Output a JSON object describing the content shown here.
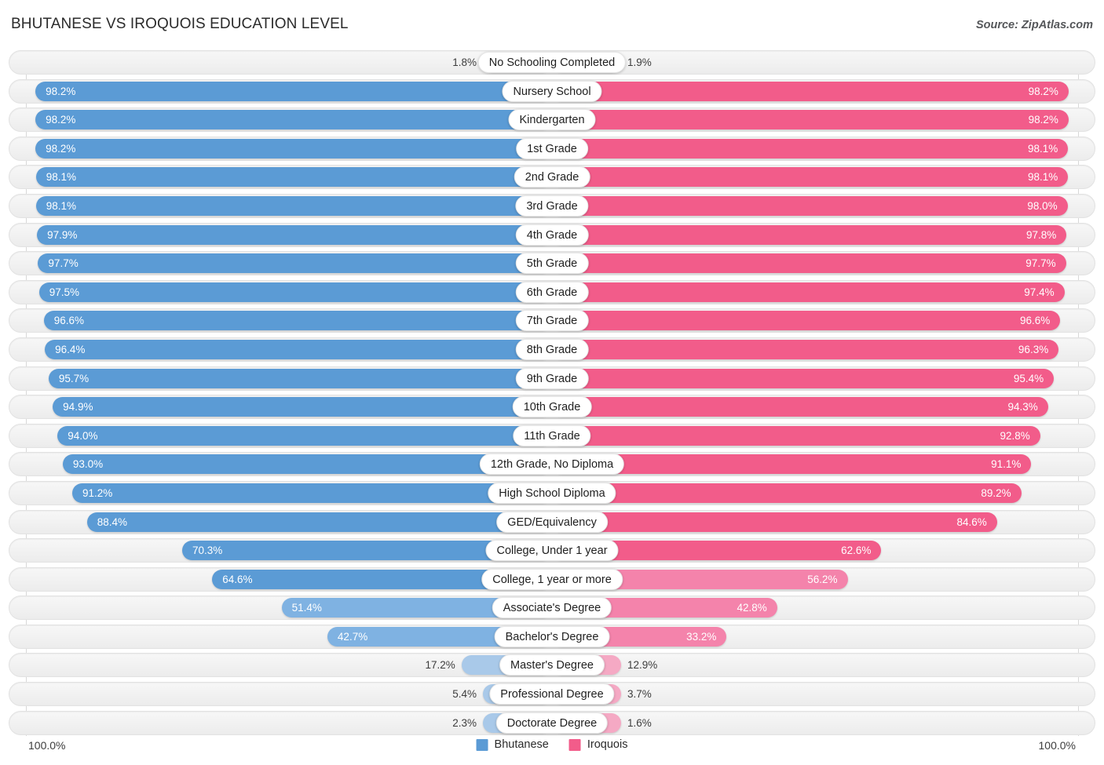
{
  "header": {
    "title": "BHUTANESE VS IROQUOIS EDUCATION LEVEL",
    "source": "Source: ZipAtlas.com"
  },
  "footer": {
    "left_axis_label": "100.0%",
    "right_axis_label": "100.0%",
    "legend": [
      {
        "label": "Bhutanese",
        "color": "#5B9BD5"
      },
      {
        "label": "Iroquois",
        "color": "#F25C8A"
      }
    ]
  },
  "colors": {
    "blue_strong": "#5B9BD5",
    "blue_mid": "#7FB2E2",
    "blue_light": "#A9C9E9",
    "pink_strong": "#F25C8A",
    "pink_mid": "#F483AB",
    "pink_light": "#F5A9C4",
    "track": "#F2F2F2",
    "axis": "#D8D8D8"
  },
  "chart_data": {
    "type": "bar",
    "subtype": "diverging-bidirectional",
    "title": "BHUTANESE VS IROQUOIS EDUCATION LEVEL",
    "xlabel": "",
    "ylabel": "",
    "xlim": [
      0,
      100
    ],
    "grid": false,
    "legend_position": "bottom-center",
    "axis_labels": {
      "left": "100.0%",
      "right": "100.0%"
    },
    "categories": [
      "No Schooling Completed",
      "Nursery School",
      "Kindergarten",
      "1st Grade",
      "2nd Grade",
      "3rd Grade",
      "4th Grade",
      "5th Grade",
      "6th Grade",
      "7th Grade",
      "8th Grade",
      "9th Grade",
      "10th Grade",
      "11th Grade",
      "12th Grade, No Diploma",
      "High School Diploma",
      "GED/Equivalency",
      "College, Under 1 year",
      "College, 1 year or more",
      "Associate's Degree",
      "Bachelor's Degree",
      "Master's Degree",
      "Professional Degree",
      "Doctorate Degree"
    ],
    "series": [
      {
        "name": "Bhutanese",
        "color": "#5B9BD5",
        "values": [
          1.8,
          98.2,
          98.2,
          98.2,
          98.1,
          98.1,
          97.9,
          97.7,
          97.5,
          96.6,
          96.4,
          95.7,
          94.9,
          94.0,
          93.0,
          91.2,
          88.4,
          70.3,
          64.6,
          51.4,
          42.7,
          17.2,
          5.4,
          2.3
        ],
        "labels": [
          "1.8%",
          "98.2%",
          "98.2%",
          "98.2%",
          "98.1%",
          "98.1%",
          "97.9%",
          "97.7%",
          "97.5%",
          "96.6%",
          "96.4%",
          "95.7%",
          "94.9%",
          "94.0%",
          "93.0%",
          "91.2%",
          "88.4%",
          "70.3%",
          "64.6%",
          "51.4%",
          "42.7%",
          "17.2%",
          "5.4%",
          "2.3%"
        ]
      },
      {
        "name": "Iroquois",
        "color": "#F25C8A",
        "values": [
          1.9,
          98.2,
          98.2,
          98.1,
          98.1,
          98.0,
          97.8,
          97.7,
          97.4,
          96.6,
          96.3,
          95.4,
          94.3,
          92.8,
          91.1,
          89.2,
          84.6,
          62.6,
          56.2,
          42.8,
          33.2,
          12.9,
          3.7,
          1.6
        ],
        "labels": [
          "1.9%",
          "98.2%",
          "98.2%",
          "98.1%",
          "98.1%",
          "98.0%",
          "97.8%",
          "97.7%",
          "97.4%",
          "96.6%",
          "96.3%",
          "95.4%",
          "94.3%",
          "92.8%",
          "91.1%",
          "89.2%",
          "84.6%",
          "62.6%",
          "56.2%",
          "42.8%",
          "33.2%",
          "12.9%",
          "3.7%",
          "1.6%"
        ]
      }
    ]
  }
}
